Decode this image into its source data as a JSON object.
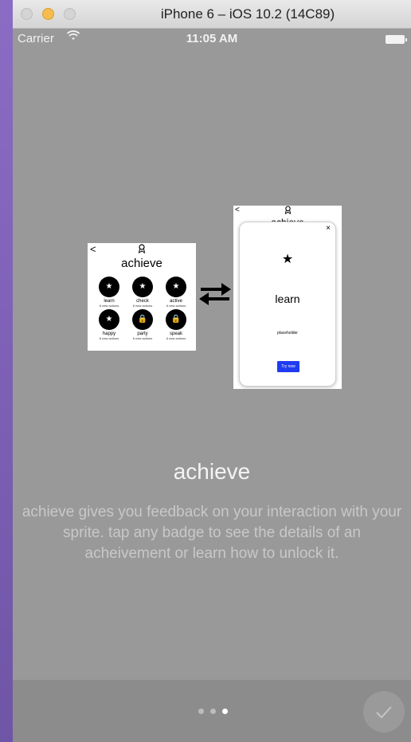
{
  "window": {
    "title": "iPhone 6 – iOS 10.2 (14C89)"
  },
  "statusbar": {
    "carrier": "Carrier",
    "time": "11:05 AM"
  },
  "mini_achieve": {
    "back": "<",
    "title": "achieve",
    "badges": [
      {
        "icon": "★",
        "name": "learn",
        "sub": "6 new actions"
      },
      {
        "icon": "★",
        "name": "check",
        "sub": "6 new actions"
      },
      {
        "icon": "★",
        "name": "active",
        "sub": "6 new actions"
      },
      {
        "icon": "★",
        "name": "happy",
        "sub": "6 new actions"
      },
      {
        "icon": "🔒",
        "name": "party",
        "sub": "6 new actions"
      },
      {
        "icon": "🔒",
        "name": "speak",
        "sub": "6 new actions"
      }
    ]
  },
  "mini_detail": {
    "back": "<",
    "peek_title": "achieve",
    "close": "×",
    "star": "★",
    "name": "learn",
    "placeholder": "placeholder",
    "button": "Try now"
  },
  "onboarding": {
    "headline": "achieve",
    "description": "achieve gives you feedback on your interaction with your sprite. tap any badge to see the details of an acheivement or learn how to unlock it.",
    "page_count": 3,
    "current_page": 3
  },
  "colors": {
    "background": "#999999",
    "bottom_bar": "#8c8c8c",
    "accent_button": "#1f3cf0"
  }
}
